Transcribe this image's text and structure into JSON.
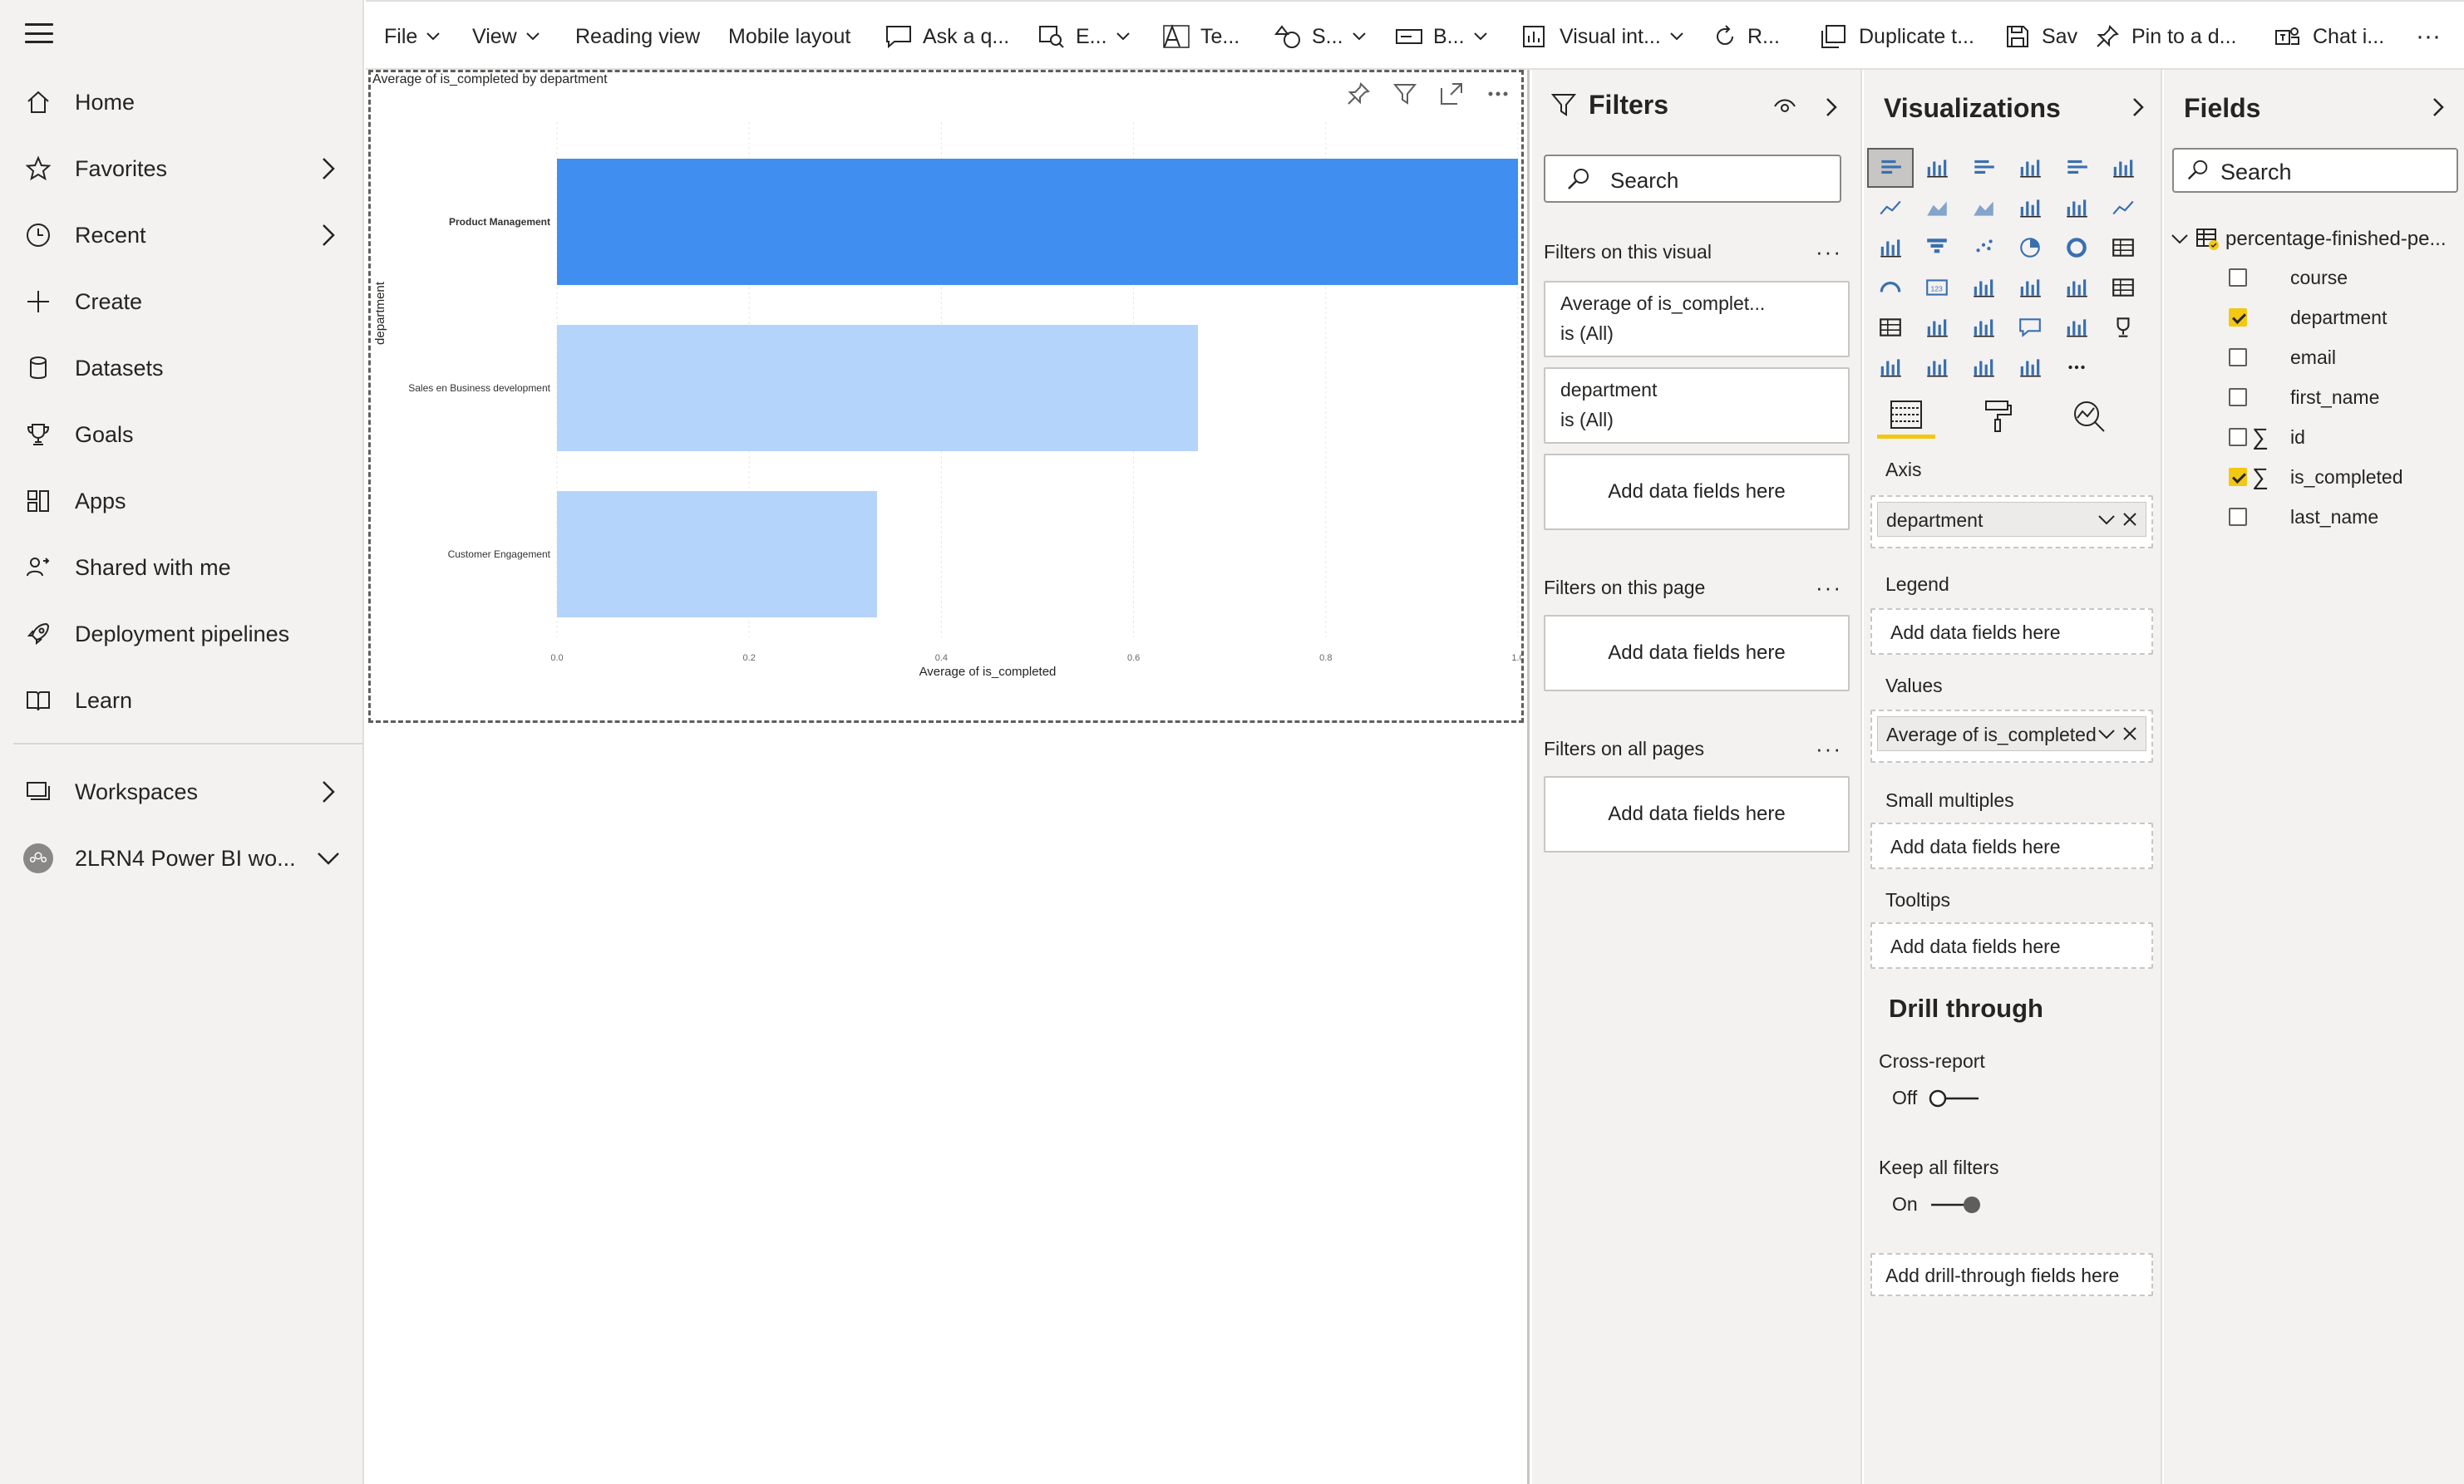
{
  "nav": {
    "items": [
      {
        "label": "Home",
        "icon": "home-icon",
        "chevron": false
      },
      {
        "label": "Favorites",
        "icon": "star-icon",
        "chevron": true
      },
      {
        "label": "Recent",
        "icon": "clock-icon",
        "chevron": true
      },
      {
        "label": "Create",
        "icon": "plus-icon",
        "chevron": false
      },
      {
        "label": "Datasets",
        "icon": "database-icon",
        "chevron": false
      },
      {
        "label": "Goals",
        "icon": "trophy-icon",
        "chevron": false
      },
      {
        "label": "Apps",
        "icon": "apps-icon",
        "chevron": false
      },
      {
        "label": "Shared with me",
        "icon": "shared-icon",
        "chevron": false
      },
      {
        "label": "Deployment pipelines",
        "icon": "rocket-icon",
        "chevron": false
      },
      {
        "label": "Learn",
        "icon": "book-icon",
        "chevron": false
      }
    ],
    "workspaces": "Workspaces",
    "workspace_current": "2LRN4 Power BI wo..."
  },
  "toolbar": {
    "file": "File",
    "view": "View",
    "reading_view": "Reading view",
    "mobile_layout": "Mobile layout",
    "ask": "Ask a q...",
    "explore": "E...",
    "text": "Te...",
    "shapes": "S...",
    "buttons": "B...",
    "visual_interactions": "Visual int...",
    "refresh": "R...",
    "duplicate": "Duplicate t...",
    "save": "Sav",
    "pin": "Pin to a d...",
    "chat": "Chat i...",
    "more": "···"
  },
  "visual": {
    "title": "Average of is_completed by department"
  },
  "chart_data": {
    "type": "bar",
    "orientation": "horizontal",
    "title": "Average of is_completed by department",
    "categories": [
      "Product Management",
      "Sales en Business development",
      "Customer Engagement"
    ],
    "values": [
      1.0,
      0.667,
      0.333
    ],
    "xlabel": "Average of is_completed",
    "ylabel": "department",
    "xlim": [
      0,
      1.0
    ],
    "xticks": [
      "0.0",
      "0.2",
      "0.4",
      "0.6",
      "0.8",
      "1.0"
    ],
    "highlighted": "Product Management",
    "colors": {
      "highlight": "#3f8ef0",
      "dimmed": "#b5d4fb"
    },
    "grid": true
  },
  "filters": {
    "title": "Filters",
    "search_placeholder": "Search",
    "on_visual": "Filters on this visual",
    "card1_line1": "Average of is_complet...",
    "card1_line2": "is (All)",
    "card2_line1": "department",
    "card2_line2": "is (All)",
    "add": "Add data fields here",
    "on_page": "Filters on this page",
    "on_all": "Filters on all pages",
    "more": "···"
  },
  "viz": {
    "title": "Visualizations",
    "axis_label": "Axis",
    "axis_value": "department",
    "legend_label": "Legend",
    "values_label": "Values",
    "values_value": "Average of is_completed",
    "small_multiples_label": "Small multiples",
    "tooltips_label": "Tooltips",
    "add": "Add data fields here",
    "drill_title": "Drill through",
    "cross_report": "Cross-report",
    "cross_report_state": "Off",
    "keep_filters": "Keep all filters",
    "keep_filters_state": "On",
    "add_drill": "Add drill-through fields here",
    "more": "···"
  },
  "fields": {
    "title": "Fields",
    "search_placeholder": "Search",
    "table": "percentage-finished-pe...",
    "items": [
      {
        "name": "course",
        "checked": false,
        "sigma": false
      },
      {
        "name": "department",
        "checked": true,
        "sigma": false
      },
      {
        "name": "email",
        "checked": false,
        "sigma": false
      },
      {
        "name": "first_name",
        "checked": false,
        "sigma": false
      },
      {
        "name": "id",
        "checked": false,
        "sigma": true
      },
      {
        "name": "is_completed",
        "checked": true,
        "sigma": true
      },
      {
        "name": "last_name",
        "checked": false,
        "sigma": false
      }
    ]
  }
}
